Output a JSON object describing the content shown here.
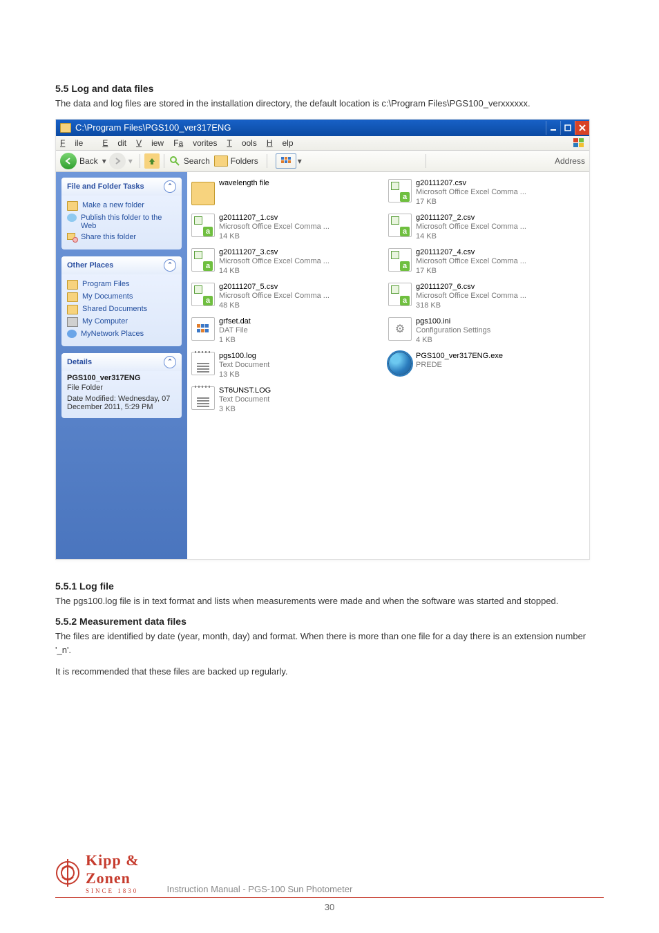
{
  "doc": {
    "section_55": "5.5 Log and data files",
    "section_55_body": "The data and log files are stored in the installation directory, the default location is c:\\Program Files\\PGS100_verxxxxxx.",
    "section_551": "5.5.1 Log file",
    "section_551_body": "The pgs100.log file is in text format and lists when measurements were made and when the software was started and stopped.",
    "section_552": "5.5.2 Measurement data files",
    "section_552_body": "The files are identified by date (year, month, day) and format. When there is more than one file for a day there is an extension number '_n'.",
    "backup_note": "It is recommended that these files are backed up regularly.",
    "footer_text": "Instruction Manual - PGS-100 Sun Photometer",
    "page_number": "30",
    "brand_top": "Kipp &",
    "brand_bottom": "Zonen",
    "brand_since": "SINCE 1830"
  },
  "explorer": {
    "title": "C:\\Program Files\\PGS100_ver317ENG",
    "menu": {
      "file": "File",
      "edit": "Edit",
      "view": "View",
      "favorites": "Favorites",
      "tools": "Tools",
      "help": "Help"
    },
    "toolbar": {
      "back": "Back",
      "search": "Search",
      "folders": "Folders",
      "address": "Address"
    },
    "sidebar": {
      "tasks": {
        "title": "File and Folder Tasks",
        "items": [
          "Make a new folder",
          "Publish this folder to the Web",
          "Share this folder"
        ]
      },
      "other": {
        "title": "Other Places",
        "items": [
          "Program Files",
          "My Documents",
          "Shared Documents",
          "My Computer",
          "MyNetwork Places"
        ]
      },
      "details": {
        "title": "Details",
        "name": "PGS100_ver317ENG",
        "type": "File Folder",
        "modified": "Date Modified: Wednesday, 07 December 2011, 5:29 PM"
      }
    },
    "files": [
      {
        "name": "wavelength file",
        "desc": "",
        "size": "",
        "icon": "folder"
      },
      {
        "name": "g20111207.csv",
        "desc": "Microsoft Office Excel Comma ...",
        "size": "17 KB",
        "icon": "excel"
      },
      {
        "name": "g20111207_1.csv",
        "desc": "Microsoft Office Excel Comma ...",
        "size": "14 KB",
        "icon": "excel"
      },
      {
        "name": "g20111207_2.csv",
        "desc": "Microsoft Office Excel Comma ...",
        "size": "14 KB",
        "icon": "excel"
      },
      {
        "name": "g20111207_3.csv",
        "desc": "Microsoft Office Excel Comma ...",
        "size": "14 KB",
        "icon": "excel"
      },
      {
        "name": "g20111207_4.csv",
        "desc": "Microsoft Office Excel Comma ...",
        "size": "17 KB",
        "icon": "excel"
      },
      {
        "name": "g20111207_5.csv",
        "desc": "Microsoft Office Excel Comma ...",
        "size": "48 KB",
        "icon": "excel"
      },
      {
        "name": "g20111207_6.csv",
        "desc": "Microsoft Office Excel Comma ...",
        "size": "318 KB",
        "icon": "excel"
      },
      {
        "name": "grfset.dat",
        "desc": "DAT File",
        "size": "1 KB",
        "icon": "dat"
      },
      {
        "name": "pgs100.ini",
        "desc": "Configuration Settings",
        "size": "4 KB",
        "icon": "ini"
      },
      {
        "name": "pgs100.log",
        "desc": "Text Document",
        "size": "13 KB",
        "icon": "txt"
      },
      {
        "name": "PGS100_ver317ENG.exe",
        "desc": "PREDE",
        "size": "",
        "icon": "exe"
      },
      {
        "name": "ST6UNST.LOG",
        "desc": "Text Document",
        "size": "3 KB",
        "icon": "txt"
      }
    ]
  }
}
